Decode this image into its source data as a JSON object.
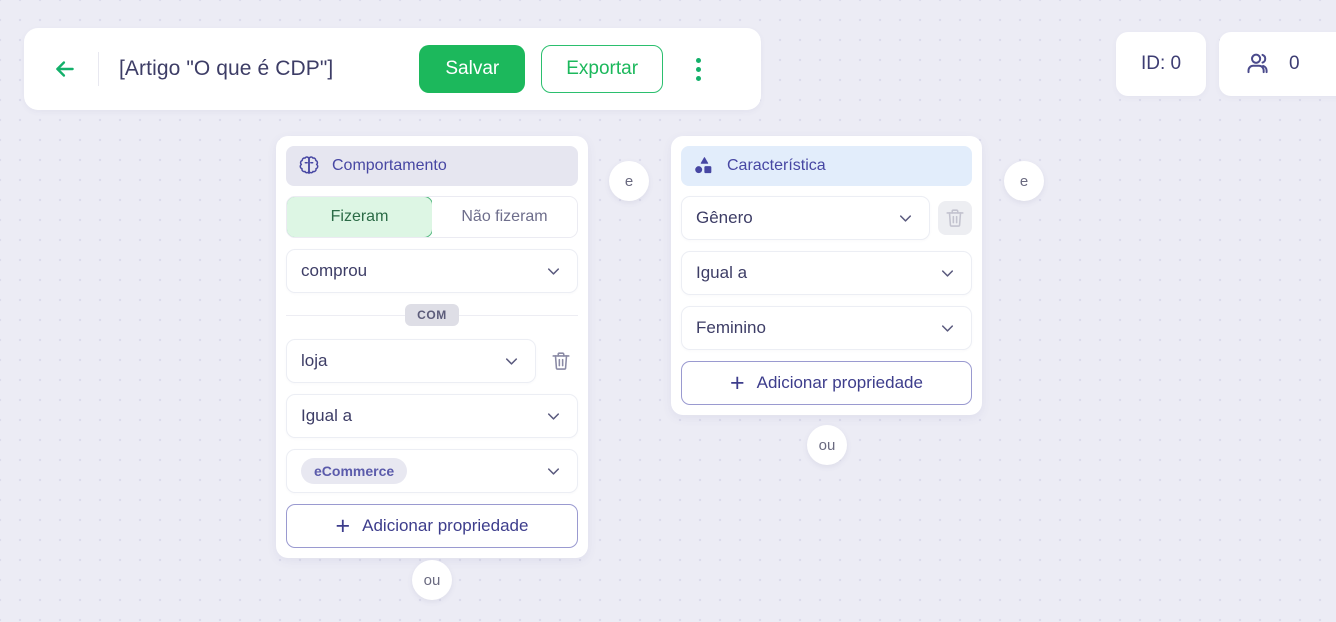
{
  "header": {
    "back_icon": "arrow-left-icon",
    "title": "[Artigo \"O que é CDP\"]",
    "save_label": "Salvar",
    "export_label": "Exportar",
    "menu_icon": "kebab-menu-icon",
    "accent_green": "#1cb85c"
  },
  "status_pills": {
    "id_label": "ID: 0",
    "audience_icon": "users-icon",
    "audience_count": "0"
  },
  "cards": [
    {
      "icon": "brain-icon",
      "title": "Comportamento",
      "header_bg": "#e6e6f0",
      "segmented": {
        "options": [
          "Fizeram",
          "Não fizeram"
        ],
        "selected": "Fizeram"
      },
      "event": {
        "value": "comprou"
      },
      "divider_label": "COM",
      "property": {
        "value": "loja",
        "delete_icon": "trash-icon"
      },
      "operator": {
        "value": "Igual a"
      },
      "value_chip": "eCommerce",
      "add_property_label": "Adicionar propriedade"
    },
    {
      "icon": "shapes-icon",
      "title": "Característica",
      "header_bg": "#e2edfb",
      "property": {
        "value": "Gênero",
        "delete_icon": "trash-icon",
        "delete_disabled": true
      },
      "operator": {
        "value": "Igual a"
      },
      "value": "Feminino",
      "add_property_label": "Adicionar propriedade"
    }
  ],
  "connectors": [
    {
      "label": "e"
    },
    {
      "label": "e"
    },
    {
      "label": "ou"
    },
    {
      "label": "ou"
    }
  ]
}
